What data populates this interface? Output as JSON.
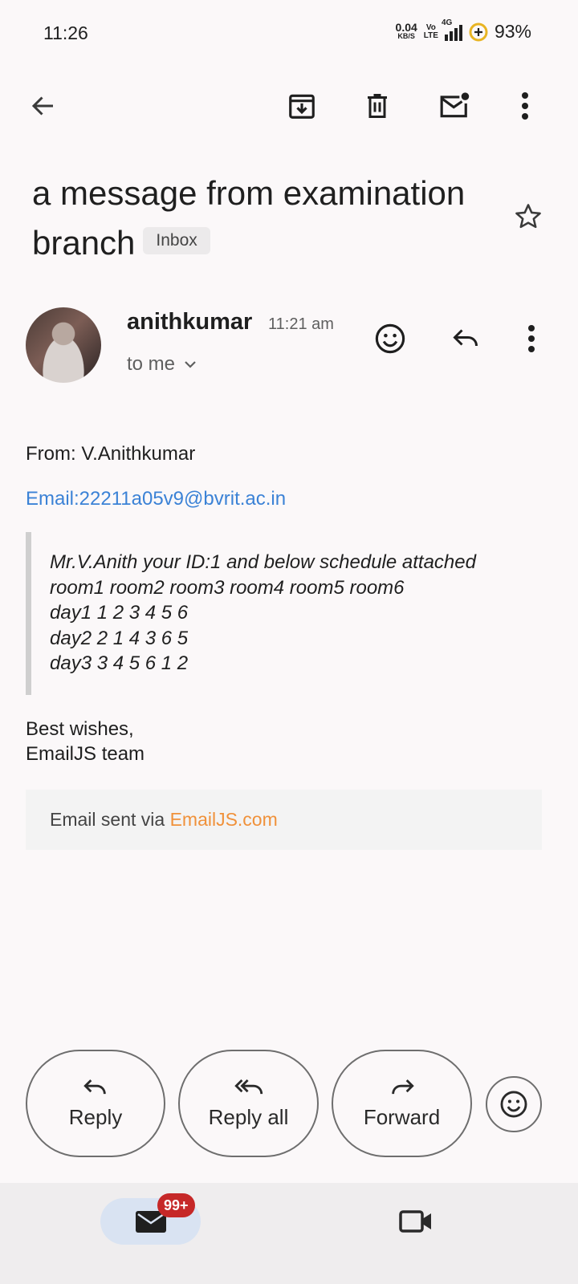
{
  "status_bar": {
    "time": "11:26",
    "net_speed_value": "0.04",
    "net_speed_unit": "KB/S",
    "volte_top": "Vo",
    "volte_bottom": "LTE",
    "network": "4G",
    "battery": "93%"
  },
  "toolbar": {
    "icons": [
      "back-arrow-icon",
      "archive-icon",
      "delete-icon",
      "mark-unread-icon",
      "more-vert-icon"
    ]
  },
  "subject": {
    "title": "a message from examination branch",
    "label_chip": "Inbox"
  },
  "sender": {
    "name": "anithkumar",
    "time": "11:21 am",
    "to": "to me"
  },
  "body": {
    "from_line": "From: V.Anithkumar",
    "email_line": "Email:22211a05v9@bvrit.ac.in",
    "quote_lines": [
      "Mr.V.Anith your ID:1 and below schedule attached",
      "room1 room2 room3 room4 room5 room6",
      "day1 1 2 3 4 5 6",
      "day2 2 1 4 3 6 5",
      "day3 3 4 5 6 1 2"
    ],
    "signoff_line1": "Best wishes,",
    "signoff_line2": "EmailJS team",
    "footer_prefix": "Email sent via ",
    "footer_link": "EmailJS.com"
  },
  "actions": {
    "reply": "Reply",
    "reply_all": "Reply all",
    "forward": "Forward"
  },
  "bottom_nav": {
    "mail_badge": "99+"
  },
  "colors": {
    "link": "#3b82d6",
    "footer_link": "#f0913a",
    "badge": "#c62828"
  }
}
